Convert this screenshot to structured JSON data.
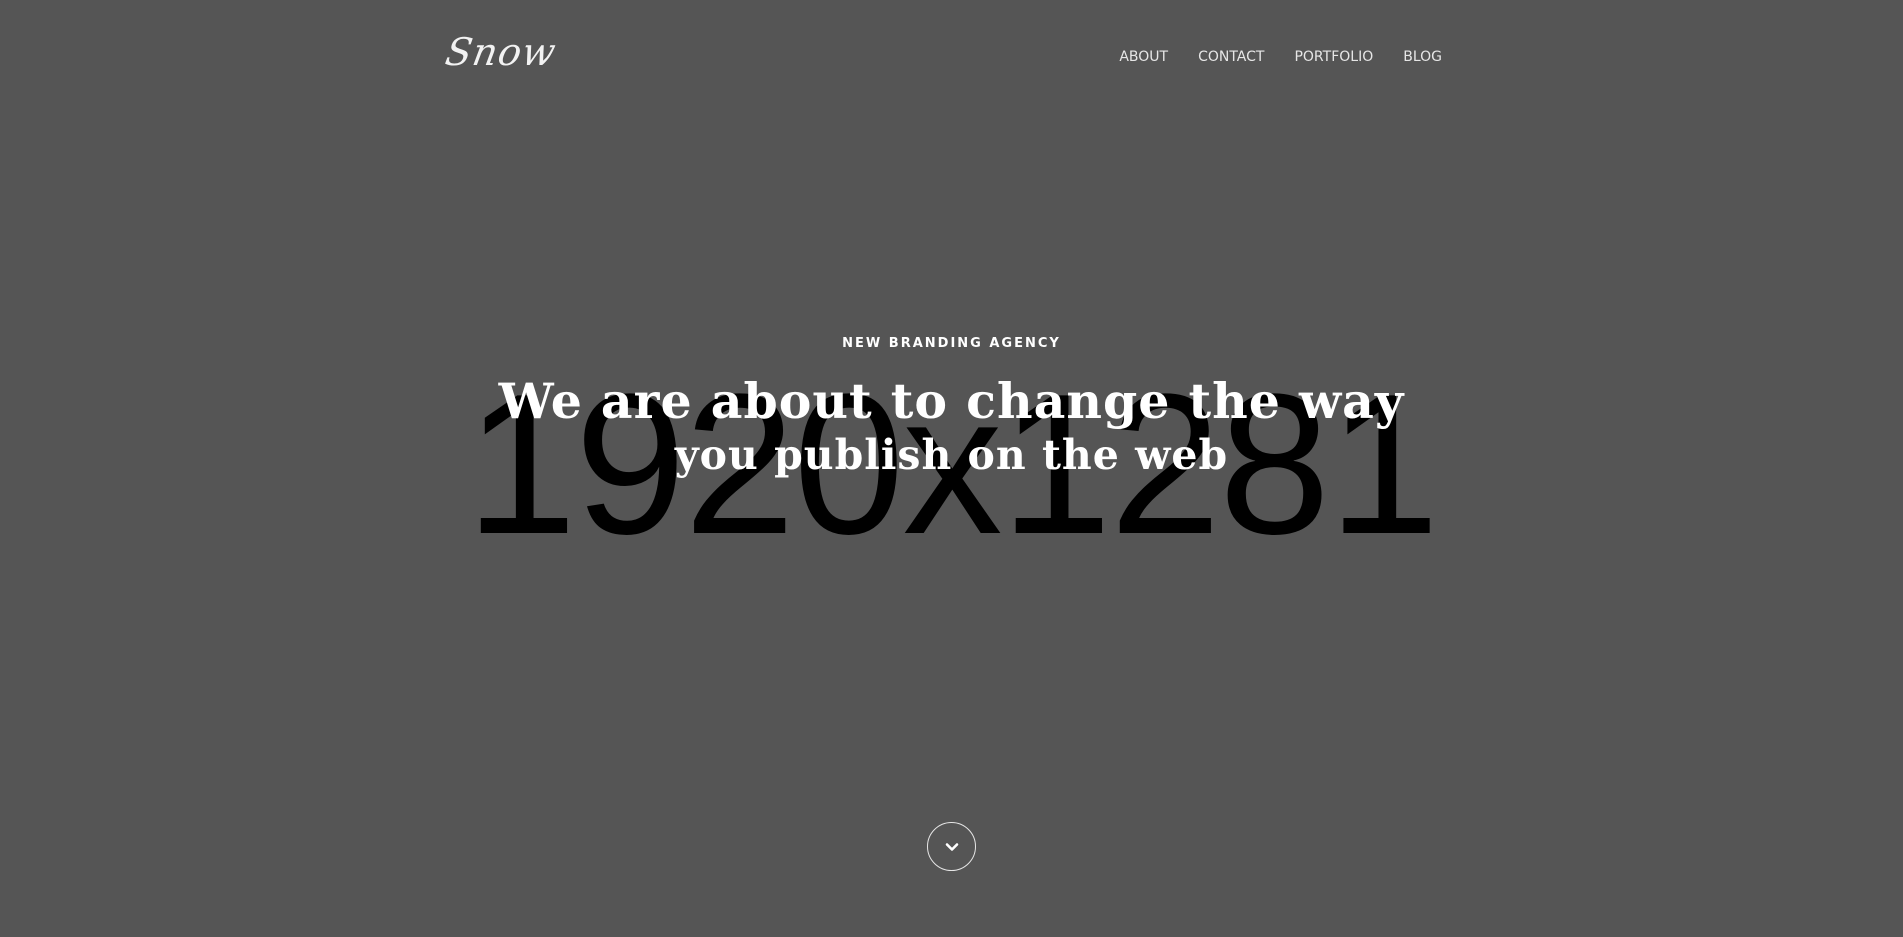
{
  "header": {
    "logo": "Snow",
    "nav": [
      {
        "label": "ABOUT"
      },
      {
        "label": "CONTACT"
      },
      {
        "label": "PORTFOLIO"
      },
      {
        "label": "BLOG"
      }
    ]
  },
  "hero": {
    "placeholder": "1920x1281",
    "eyebrow": "NEW BRANDING AGENCY",
    "title_line1": "We are about to change the way",
    "title_line2": "you publish on the web",
    "scroll_icon": "chevron-down-icon"
  },
  "colors": {
    "background": "#555555",
    "text": "#ffffff",
    "placeholder": "#000000"
  }
}
